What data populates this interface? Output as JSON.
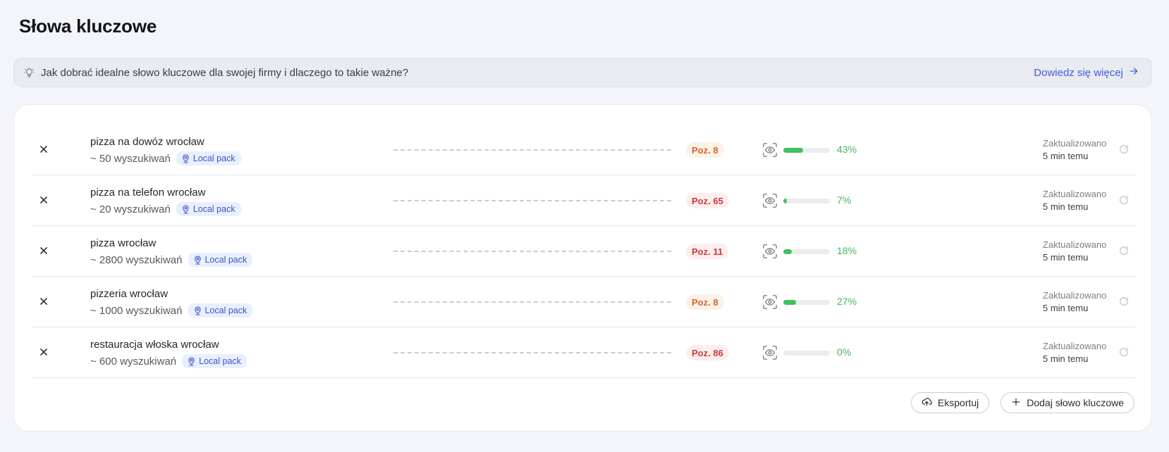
{
  "page": {
    "title": "Słowa kluczowe"
  },
  "tip": {
    "text": "Jak dobrać idealne słowo kluczowe dla swojej firmy i dlaczego to takie ważne?",
    "link_label": "Dowiedz się więcej"
  },
  "keywords": [
    {
      "name": "pizza na dowóz wrocław",
      "volume": "~ 50 wyszukiwań",
      "badge": "Local pack",
      "position": "Poz. 8",
      "position_tone": "orange",
      "visibility_pct": 43,
      "visibility_label": "43%",
      "updated_label": "Zaktualizowano",
      "updated_time": "5 min temu"
    },
    {
      "name": "pizza na telefon wrocław",
      "volume": "~ 20 wyszukiwań",
      "badge": "Local pack",
      "position": "Poz. 65",
      "position_tone": "red",
      "visibility_pct": 7,
      "visibility_label": "7%",
      "updated_label": "Zaktualizowano",
      "updated_time": "5 min temu"
    },
    {
      "name": "pizza wrocław",
      "volume": "~ 2800 wyszukiwań",
      "badge": "Local pack",
      "position": "Poz. 11",
      "position_tone": "red",
      "visibility_pct": 18,
      "visibility_label": "18%",
      "updated_label": "Zaktualizowano",
      "updated_time": "5 min temu"
    },
    {
      "name": "pizzeria wrocław",
      "volume": "~ 1000 wyszukiwań",
      "badge": "Local pack",
      "position": "Poz. 8",
      "position_tone": "orange",
      "visibility_pct": 27,
      "visibility_label": "27%",
      "updated_label": "Zaktualizowano",
      "updated_time": "5 min temu"
    },
    {
      "name": "restauracja włoska wrocław",
      "volume": "~ 600 wyszukiwań",
      "badge": "Local pack",
      "position": "Poz. 86",
      "position_tone": "red",
      "visibility_pct": 0,
      "visibility_label": "0%",
      "updated_label": "Zaktualizowano",
      "updated_time": "5 min temu"
    }
  ],
  "actions": {
    "export_label": "Eksportuj",
    "add_label": "Dodaj słowo kluczowe"
  },
  "colors": {
    "accent": "#3c5fd6",
    "progress": "#3fc25f",
    "position_orange": "#d2682a",
    "position_red": "#c73a3a"
  }
}
